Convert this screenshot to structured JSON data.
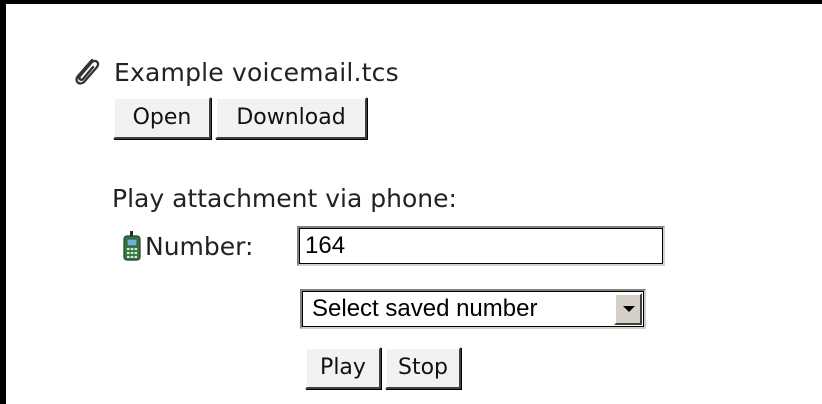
{
  "attachment": {
    "icon": "paperclip-icon",
    "filename": "Example voicemail.tcs",
    "open_label": "Open",
    "download_label": "Download"
  },
  "phone_playback": {
    "heading": "Play attachment via phone:",
    "icon": "mobile-phone-icon",
    "number_label": "Number:",
    "number_value": "164",
    "saved_number_select": "Select saved number",
    "play_label": "Play",
    "stop_label": "Stop"
  },
  "colors": {
    "border": "#000000",
    "button_face": "#f2f2f0",
    "phone_body": "#3a7d44",
    "phone_screen": "#6fb0d8"
  }
}
